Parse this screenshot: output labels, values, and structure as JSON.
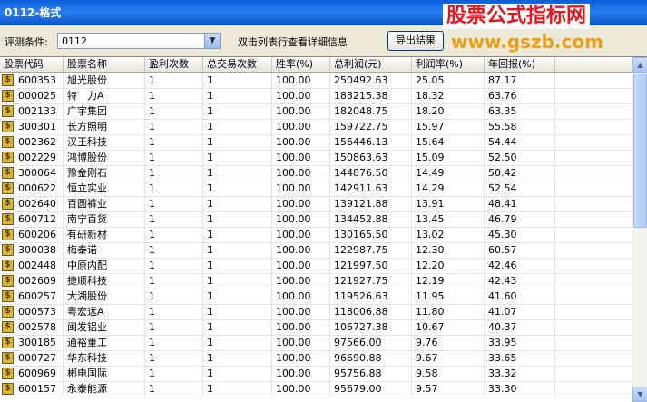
{
  "window": {
    "title": "0112-格式"
  },
  "watermark": {
    "name": "股票公式指标网",
    "url": "www.gszb.com"
  },
  "filter": {
    "label": "评测条件:",
    "value": "0112"
  },
  "hint": "双击列表行查看详细信息",
  "export_label": "导出结果",
  "table": {
    "headers": [
      "股票代码",
      "股票名称",
      "盈利次数",
      "总交易次数",
      "胜率(%)",
      "总利润(元)",
      "利润率(%)",
      "年回报(%)"
    ],
    "rows": [
      [
        "600353",
        "旭光股份",
        "1",
        "1",
        "100.00",
        "250492.63",
        "25.05",
        "87.17"
      ],
      [
        "000025",
        "特　力A",
        "1",
        "1",
        "100.00",
        "183215.38",
        "18.32",
        "63.76"
      ],
      [
        "002133",
        "广宇集团",
        "1",
        "1",
        "100.00",
        "182048.75",
        "18.20",
        "63.35"
      ],
      [
        "300301",
        "长方照明",
        "1",
        "1",
        "100.00",
        "159722.75",
        "15.97",
        "55.58"
      ],
      [
        "002362",
        "汉王科技",
        "1",
        "1",
        "100.00",
        "156446.13",
        "15.64",
        "54.44"
      ],
      [
        "002229",
        "鸿博股份",
        "1",
        "1",
        "100.00",
        "150863.63",
        "15.09",
        "52.50"
      ],
      [
        "300064",
        "豫金刚石",
        "1",
        "1",
        "100.00",
        "144876.50",
        "14.49",
        "50.42"
      ],
      [
        "000622",
        "恒立实业",
        "1",
        "1",
        "100.00",
        "142911.63",
        "14.29",
        "52.54"
      ],
      [
        "002640",
        "百圆裤业",
        "1",
        "1",
        "100.00",
        "139121.88",
        "13.91",
        "48.41"
      ],
      [
        "600712",
        "南宁百货",
        "1",
        "1",
        "100.00",
        "134452.88",
        "13.45",
        "46.79"
      ],
      [
        "600206",
        "有研新材",
        "1",
        "1",
        "100.00",
        "130165.50",
        "13.02",
        "45.30"
      ],
      [
        "300038",
        "梅泰诺",
        "1",
        "1",
        "100.00",
        "122987.75",
        "12.30",
        "60.57"
      ],
      [
        "002448",
        "中原内配",
        "1",
        "1",
        "100.00",
        "121997.50",
        "12.20",
        "42.46"
      ],
      [
        "002609",
        "捷顺科技",
        "1",
        "1",
        "100.00",
        "121927.75",
        "12.19",
        "42.43"
      ],
      [
        "600257",
        "大湖股份",
        "1",
        "1",
        "100.00",
        "119526.63",
        "11.95",
        "41.60"
      ],
      [
        "000573",
        "粤宏远A",
        "1",
        "1",
        "100.00",
        "118006.88",
        "11.80",
        "41.07"
      ],
      [
        "002578",
        "闽发铝业",
        "1",
        "1",
        "100.00",
        "106727.38",
        "10.67",
        "40.37"
      ],
      [
        "300185",
        "通裕重工",
        "1",
        "1",
        "100.00",
        "97566.00",
        "9.76",
        "33.95"
      ],
      [
        "000727",
        "华东科技",
        "1",
        "1",
        "100.00",
        "96690.88",
        "9.67",
        "33.65"
      ],
      [
        "600969",
        "郴电国际",
        "1",
        "1",
        "100.00",
        "95756.88",
        "9.58",
        "33.32"
      ],
      [
        "600157",
        "永泰能源",
        "1",
        "1",
        "100.00",
        "95679.00",
        "9.57",
        "33.30"
      ]
    ]
  }
}
